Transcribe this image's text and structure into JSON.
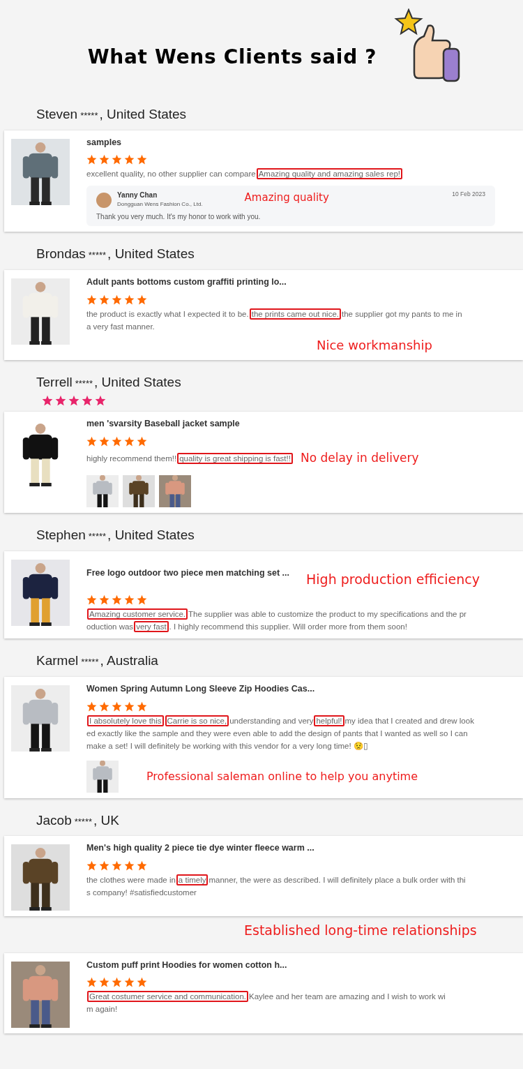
{
  "title": "What Wens Clients said ?",
  "reviews": [
    {
      "reviewer": "Steven",
      "mask": "*****",
      "location": ", United States",
      "product": "samples",
      "stars": 5,
      "photo": {
        "kind": "picture"
      },
      "comment_lines": [
        [
          {
            "text": "excellent quality, no other supplier can compare",
            "highlighted": false
          },
          {
            "text": "Amazing quality and amazing sales rep!",
            "highlighted": true
          }
        ]
      ],
      "reply": {
        "name": "Yanny Chan",
        "company": "Dongguan Wens Fashion Co., Ltd.",
        "date": "10 Feb 2023",
        "message": "Thank you very much. It's my honor to work with you.",
        "callout": "Amazing quality"
      }
    },
    {
      "reviewer": "Brondas",
      "mask": "*****",
      "location": ", United States",
      "product": "Adult pants bottoms custom graffiti printing lo...",
      "stars": 5,
      "photo": {
        "kind": "picture"
      },
      "comment_lines": [
        [
          {
            "text": "the product is exactly what I expected it to be.",
            "highlighted": false
          },
          {
            "text": "the prints came out nice.",
            "highlighted": true
          },
          {
            "text": "the supplier got my pants to me in",
            "highlighted": false
          }
        ],
        [
          {
            "text": "a very fast manner.",
            "highlighted": false
          }
        ]
      ],
      "callout": {
        "text": "Nice workmanship",
        "kind": "below"
      }
    },
    {
      "reviewer": "Terrell",
      "mask": "*****",
      "location": ", United States",
      "header_rating": {
        "stars": 5
      },
      "product": "men 'svarsity Baseball jacket sample",
      "stars": 5,
      "photo": {
        "kind": "picture"
      },
      "comment_lines": [
        [
          {
            "text": "highly recommend them!!",
            "highlighted": false
          },
          {
            "text": "quality is great shipping is fast!!",
            "highlighted": true
          }
        ]
      ],
      "callout": {
        "text": "No delay in delivery",
        "kind": "inline"
      },
      "photos": [
        {
          "kind": "picture"
        },
        {
          "kind": "picture"
        },
        {
          "kind": "picture"
        }
      ]
    },
    {
      "reviewer": "Stephen",
      "mask": "*****",
      "location": ", United States",
      "product": "Free logo outdoor two piece men matching set ...",
      "stars": 5,
      "photo": {
        "kind": "picture"
      },
      "comment_lines": [
        [
          {
            "text": "Amazing customer service.",
            "highlighted": true
          },
          {
            "text": "The supplier was able to customize the product to my specifications and the pr",
            "highlighted": false
          }
        ],
        [
          {
            "text": "oduction was",
            "highlighted": false
          },
          {
            "text": "very fast",
            "highlighted": true
          },
          {
            "text": ". I highly recommend this supplier. Will order more from them soon!",
            "highlighted": false
          }
        ]
      ],
      "callout": {
        "text": "High production efficiency",
        "kind": "title"
      }
    },
    {
      "reviewer": "Karmel",
      "mask": "*****",
      "location": ", Australia",
      "product": "Women Spring Autumn Long Sleeve Zip Hoodies Cas...",
      "stars": 5,
      "photo": {
        "kind": "picture"
      },
      "comment_lines": [
        [
          {
            "text": "I absolutely love this",
            "highlighted": true
          },
          {
            "text": "Carrie is so nice,",
            "highlighted": true
          },
          {
            "text": "understanding and very",
            "highlighted": false
          },
          {
            "text": "helpful!",
            "highlighted": true
          },
          {
            "text": "my idea that I created and drew look",
            "highlighted": false
          }
        ],
        [
          {
            "text": "ed exactly like the sample and they were even able to add the design of pants that I wanted as well so I can",
            "highlighted": false
          }
        ],
        [
          {
            "text": "make a set! I will definitely be working with this vendor for a very long time! 😟▯",
            "highlighted": false
          }
        ]
      ],
      "callout": {
        "text": "Professional saleman online to help you anytime",
        "kind": "photos"
      },
      "photos": [
        {
          "kind": "picture"
        }
      ]
    },
    {
      "reviewer": "Jacob",
      "mask": "*****",
      "location": ", UK",
      "product": "Men's high quality 2 piece tie dye winter fleece warm ...",
      "stars": 5,
      "photo": {
        "kind": "picture"
      },
      "comment_lines": [
        [
          {
            "text": "the clothes were made in",
            "highlighted": false
          },
          {
            "text": "a timely",
            "highlighted": true
          },
          {
            "text": "manner, the were as described. I will definitely place a bulk order with thi",
            "highlighted": false
          }
        ],
        [
          {
            "text": "s company! #satisfiedcustomer",
            "highlighted": false
          }
        ]
      ],
      "callout": {
        "text": "Established long-time relationships",
        "kind": "after"
      }
    },
    {
      "product": "Custom puff print Hoodies for women cotton h...",
      "stars": 5,
      "photo": {
        "kind": "picture"
      },
      "comment_lines": [
        [
          {
            "text": "Great costumer service and communication.",
            "highlighted": true
          },
          {
            "text": "Kaylee and her team are amazing and I wish to work wi",
            "highlighted": false
          }
        ],
        [
          {
            "text": "m again!",
            "highlighted": false
          }
        ]
      ]
    }
  ]
}
